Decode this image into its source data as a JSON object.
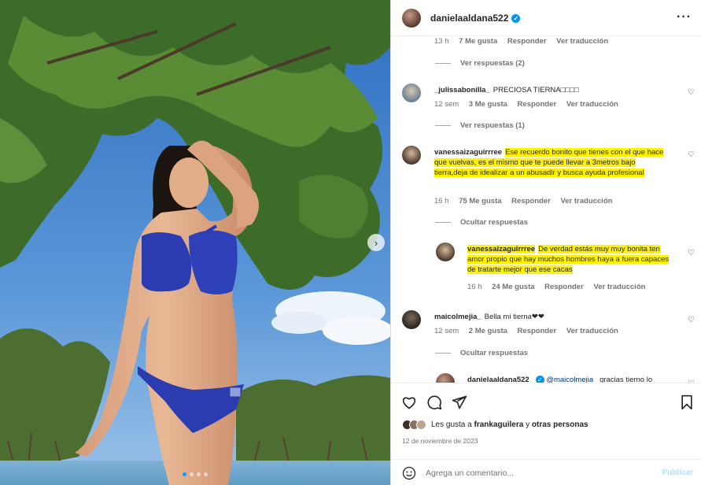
{
  "post": {
    "author": "danielaaldana522",
    "more_icon": "ellipsis-icon",
    "image_dots_count": 4,
    "image_dots_active_index": 0
  },
  "comments": {
    "c0_meta": {
      "time": "13 h",
      "likes": "7 Me gusta",
      "reply": "Responder",
      "translate": "Ver traducción"
    },
    "c0_view_replies": "Ver respuestas (2)",
    "c1": {
      "user": "_julissabonilla_",
      "text": "PRECIOSA TIERNA□□□□",
      "time": "12 sem",
      "likes": "3 Me gusta",
      "reply": "Responder",
      "translate": "Ver traducción",
      "view_replies": "Ver respuestas (1)"
    },
    "c2": {
      "user": "vanessaizaguirrree",
      "text": "Ese recuerdo bonito que tienes con el que hace que vuelvas, es el mismo que te puede llevar a 3metros bajo tierra,deja de idealizar a un abusadlr y busca ayuda profesional",
      "time": "16 h",
      "likes": "75 Me gusta",
      "reply": "Responder",
      "translate": "Ver traducción",
      "hide_replies": "Ocultar respuestas"
    },
    "c2r": {
      "user": "vanessaizaguirrree",
      "text": "De verdad estás muy muy bonita ten amor propio que hay muchos hombres haya a fuera capaces de tratarte mejor que ese cacas",
      "time": "16 h",
      "likes": "24 Me gusta",
      "reply": "Responder",
      "translate": "Ver traducción"
    },
    "c3": {
      "user": "maicolmejia_",
      "text": "Bella mi tierna❤︎❤︎",
      "time": "12 sem",
      "likes": "2 Me gusta",
      "reply": "Responder",
      "translate": "Ver traducción",
      "hide_replies": "Ocultar respuestas"
    },
    "c3r": {
      "user": "danielaaldana522",
      "mention": "@maicolmejia_",
      "text": "gracias tierno lo"
    }
  },
  "actions": {
    "likes_prefix": "Les gusta a",
    "likes_user": "frankaguilera",
    "likes_mid": "y",
    "likes_others": "otras personas",
    "date": "12 de noviembre de 2023",
    "comment_placeholder": "Agrega un comentario...",
    "publish_label": "Publicar"
  },
  "colors": {
    "accent": "#0095f6",
    "highlight": "#fff200",
    "muted": "#737373"
  }
}
